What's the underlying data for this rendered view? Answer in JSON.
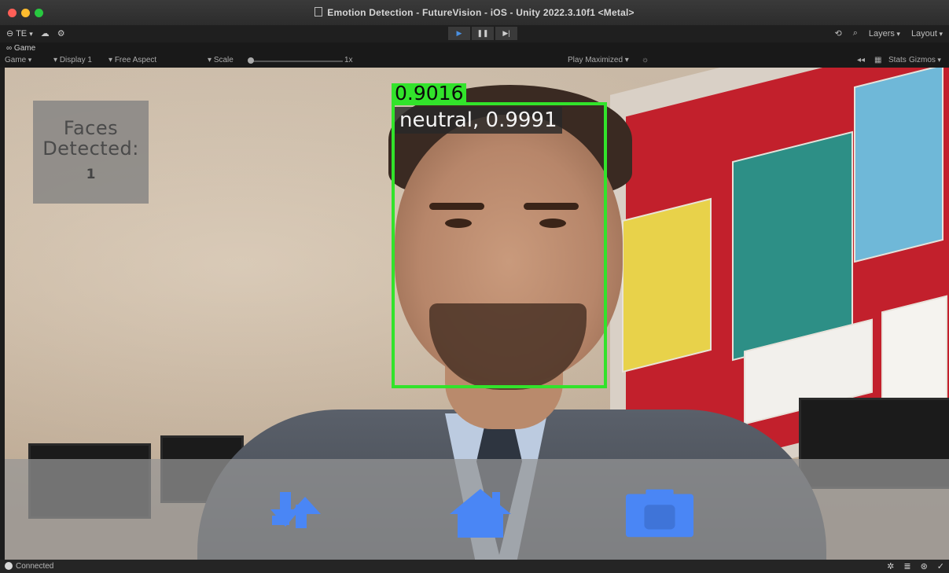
{
  "window": {
    "title": "Emotion Detection - FutureVision - iOS - Unity 2022.3.10f1 <Metal>"
  },
  "toolbar": {
    "account_label": "TE",
    "layers_label": "Layers",
    "layout_label": "Layout"
  },
  "game_view": {
    "tab_label": "Game",
    "view_mode": "Game",
    "display": "Display 1",
    "aspect": "Free Aspect",
    "scale_label": "Scale",
    "scale_value": "1x",
    "play_maximized": "Play Maximized",
    "stats_label": "Stats",
    "gizmos_label": "Gizmos"
  },
  "detection": {
    "confidence": "0.9016",
    "emotion_label": "neutral, 0.9991",
    "box_color": "#32e32b"
  },
  "faces_panel": {
    "label": "Faces Detected:",
    "count": "1"
  },
  "nav": {
    "accent": "#4a86f5",
    "buttons": [
      {
        "icon": "switch-camera-icon"
      },
      {
        "icon": "home-icon"
      },
      {
        "icon": "camera-icon"
      }
    ]
  },
  "status": {
    "text": "Connected"
  }
}
